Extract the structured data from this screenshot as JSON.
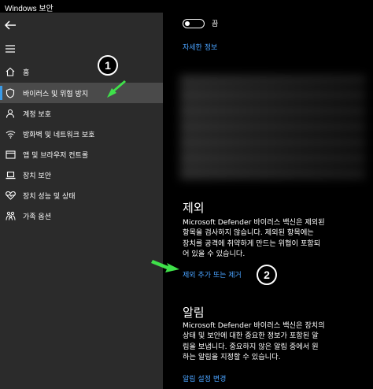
{
  "window": {
    "title": "Windows 보안"
  },
  "sidebar": {
    "items": [
      {
        "label": "홈",
        "icon": "home-icon"
      },
      {
        "label": "바이러스 및 위협 방지",
        "icon": "shield-icon",
        "selected": true
      },
      {
        "label": "계정 보호",
        "icon": "person-icon"
      },
      {
        "label": "방화벽 및 네트워크 보호",
        "icon": "wifi-icon"
      },
      {
        "label": "앱 및 브라우저 컨트롤",
        "icon": "browser-icon"
      },
      {
        "label": "장치 보안",
        "icon": "laptop-icon"
      },
      {
        "label": "장치 성능 및 상태",
        "icon": "heart-icon"
      },
      {
        "label": "가족 옵션",
        "icon": "family-icon"
      }
    ]
  },
  "callouts": {
    "one": "1",
    "two": "2"
  },
  "main": {
    "toggle_label": "끔",
    "details_link": "자세한 정보",
    "exclusions": {
      "title": "제외",
      "description": "Microsoft Defender 바이러스 백신은 제외된\n항목을 검사하지 않습니다. 제외된 항목에는\n장치를 공격에 취약하게 만드는 위협이 포함되\n어 있을 수 있습니다.",
      "link": "제외 추가 또는 제거"
    },
    "notifications": {
      "title": "알림",
      "description": "Microsoft Defender 바이러스 백신은 장치의\n상태 및 보안에 대한 중요한 정보가 포함된 알\n림을 보냅니다. 중요하지 않은 알림 중에서 원\n하는 알림을 지정할 수 있습니다.",
      "link": "알림 설정 변경"
    }
  },
  "colors": {
    "accent": "#4aa3ff",
    "sidebar_bg": "#2b2b2b",
    "selected_bg": "#4a4a4a",
    "arrow": "#3fe14a"
  }
}
